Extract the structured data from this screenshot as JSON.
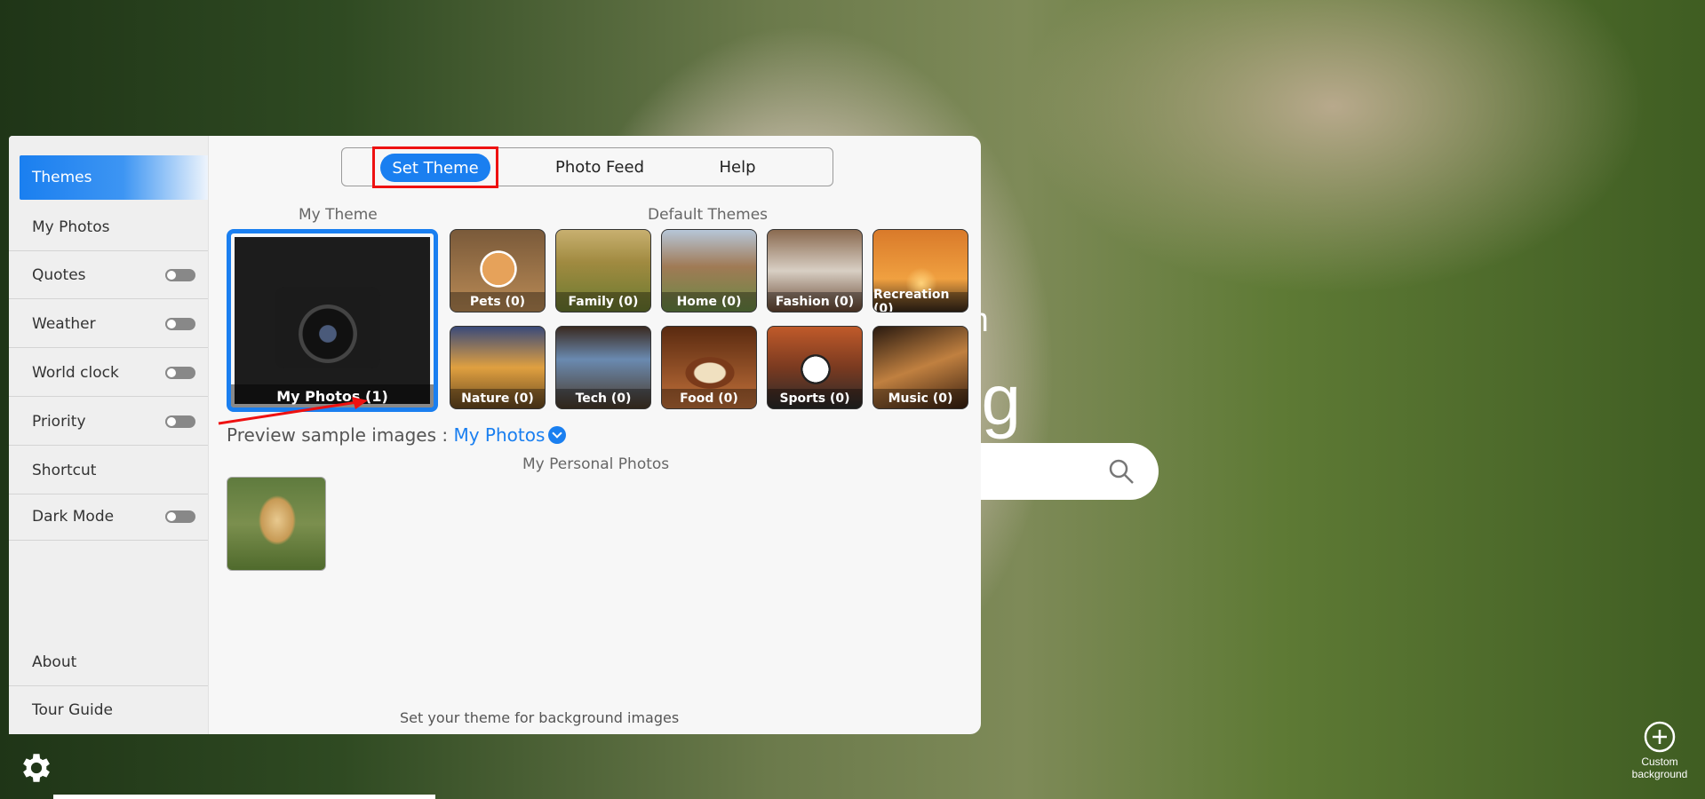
{
  "background": {
    "clock_ampm": "am",
    "greeting": "ng"
  },
  "sidebar": {
    "items": [
      {
        "label": "Themes",
        "active": true
      },
      {
        "label": "My Photos"
      },
      {
        "label": "Quotes",
        "toggle": "off"
      },
      {
        "label": "Weather",
        "toggle": "off"
      },
      {
        "label": "World clock",
        "toggle": "off"
      },
      {
        "label": "Priority",
        "toggle": "off"
      },
      {
        "label": "Shortcut"
      },
      {
        "label": "Dark Mode",
        "toggle": "off"
      }
    ],
    "footer": [
      {
        "label": "About"
      },
      {
        "label": "Tour Guide"
      }
    ]
  },
  "tabs": {
    "set_theme": "Set Theme",
    "photo_feed": "Photo Feed",
    "help": "Help"
  },
  "my_theme": {
    "label": "My Theme",
    "caption": "My Photos (1)"
  },
  "default_themes": {
    "label": "Default Themes",
    "tiles": [
      {
        "caption": "Pets (0)"
      },
      {
        "caption": "Family (0)"
      },
      {
        "caption": "Home (0)"
      },
      {
        "caption": "Fashion (0)"
      },
      {
        "caption": "Recreation (0)"
      },
      {
        "caption": "Nature (0)"
      },
      {
        "caption": "Tech (0)"
      },
      {
        "caption": "Food (0)"
      },
      {
        "caption": "Sports (0)"
      },
      {
        "caption": "Music (0)"
      }
    ]
  },
  "preview": {
    "label": "Preview sample images :",
    "selected": "My Photos"
  },
  "personal_photos": {
    "label": "My Personal Photos"
  },
  "bottom_note": "Set your theme for background images",
  "custom_background": {
    "line1": "Custom",
    "line2": "background"
  },
  "colors": {
    "accent": "#1a7ff0",
    "highlight_box": "#ee1111"
  }
}
